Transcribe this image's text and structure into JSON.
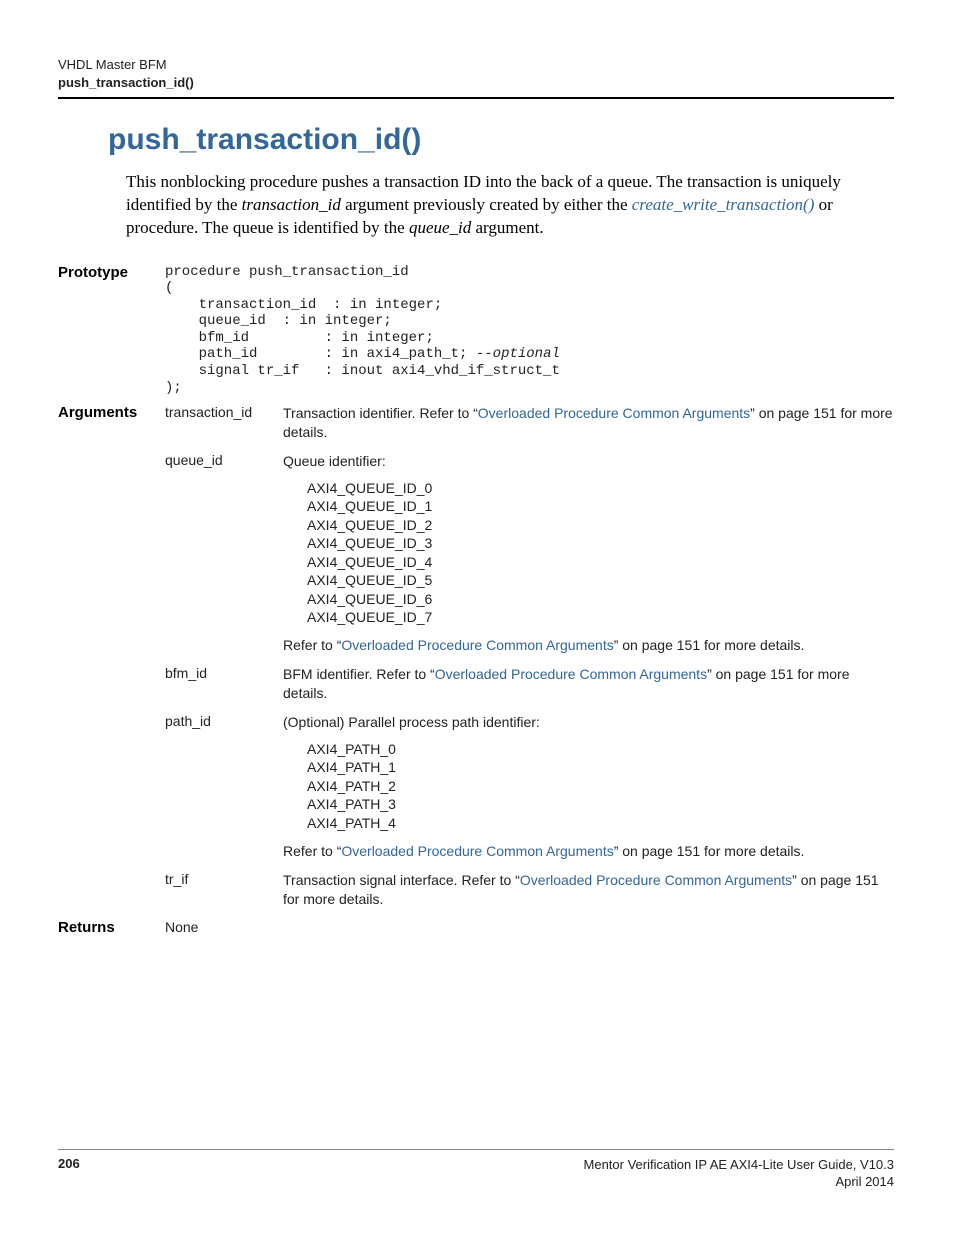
{
  "header": {
    "line1": "VHDL Master BFM",
    "line2": "push_transaction_id()"
  },
  "title": "push_transaction_id()",
  "intro": {
    "p1a": "This nonblocking procedure pushes a transaction ID into the back of a queue. The transaction is uniquely identified by the ",
    "p1b": "transaction_id",
    "p1c": " argument previously created by either the ",
    "link": "create_write_transaction()",
    "p1d": " or  procedure. The queue is identified by the ",
    "p1e": "queue_id",
    "p1f": " argument."
  },
  "labels": {
    "prototype": "Prototype",
    "arguments": "Arguments",
    "returns": "Returns"
  },
  "prototype": {
    "l0": "procedure push_transaction_id",
    "l1": "(",
    "l2": "    transaction_id  : in integer;",
    "l3": "    queue_id  : in integer;",
    "l4": "    bfm_id         : in integer;",
    "l5a": "    path_id        : in axi4_path_t; ",
    "l5b": "--optional",
    "l6": "    signal tr_if   : inout axi4_vhd_if_struct_t",
    "l7": ");"
  },
  "overloaded_link": "Overloaded Procedure Common Arguments",
  "args": {
    "transaction_id": {
      "name": "transaction_id",
      "d1": "Transaction identifier. Refer to “",
      "d2": "” on page 151 for more details."
    },
    "queue_id": {
      "name": "queue_id",
      "d0": "Queue identifier:",
      "enum": [
        "AXI4_QUEUE_ID_0",
        "AXI4_QUEUE_ID_1",
        "AXI4_QUEUE_ID_2",
        "AXI4_QUEUE_ID_3",
        "AXI4_QUEUE_ID_4",
        "AXI4_QUEUE_ID_5",
        "AXI4_QUEUE_ID_6",
        "AXI4_QUEUE_ID_7"
      ],
      "d1": "Refer to “",
      "d2": "” on page 151 for more details."
    },
    "bfm_id": {
      "name": "bfm_id",
      "d1": "BFM identifier. Refer to “",
      "d2": "” on page 151 for more details."
    },
    "path_id": {
      "name": "path_id",
      "d0": "(Optional) Parallel process path identifier:",
      "enum": [
        "AXI4_PATH_0",
        "AXI4_PATH_1",
        "AXI4_PATH_2",
        "AXI4_PATH_3",
        "AXI4_PATH_4"
      ],
      "d1": "Refer to “",
      "d2": "” on page 151 for more details."
    },
    "tr_if": {
      "name": "tr_if",
      "d1": "Transaction signal interface. Refer to “",
      "d2": "” on page 151 for more details."
    }
  },
  "returns": "None",
  "footer": {
    "page": "206",
    "doc": "Mentor Verification IP AE AXI4-Lite User Guide, V10.3",
    "date": "April 2014"
  }
}
